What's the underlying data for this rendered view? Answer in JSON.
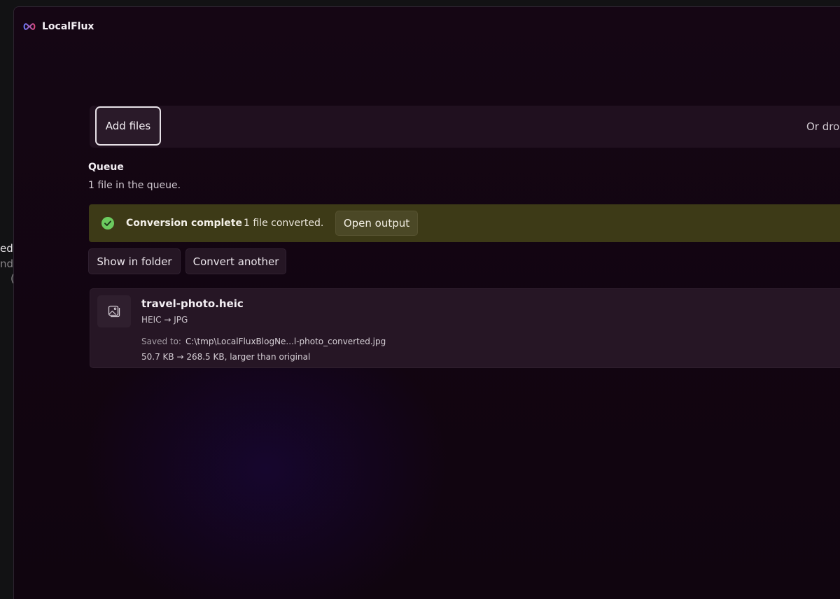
{
  "background_window": {
    "partial_line_1": "ed",
    "partial_line_2": "nd",
    "partial_line_3": "("
  },
  "app": {
    "title": "LocalFlux",
    "logo_icon": "infinity-logo-icon"
  },
  "drop_area": {
    "add_files_label": "Add files",
    "hint": "Or dro"
  },
  "queue": {
    "title": "Queue",
    "count_text": "1 file in the queue."
  },
  "status_banner": {
    "icon": "check-circle-icon",
    "title": "Conversion complete",
    "message": "1 file converted.",
    "open_output_label": "Open output",
    "color": "#3d3a17"
  },
  "actions": {
    "show_in_folder_label": "Show in folder",
    "convert_another_label": "Convert another"
  },
  "file": {
    "icon": "image-icon",
    "name": "travel-photo.heic",
    "conversion": "HEIC → JPG",
    "saved_label": "Saved to:",
    "saved_path": "C:\\tmp\\LocalFluxBlogNe...l-photo_converted.jpg",
    "size_info": "50.7 KB → 268.5 KB, larger than original"
  }
}
